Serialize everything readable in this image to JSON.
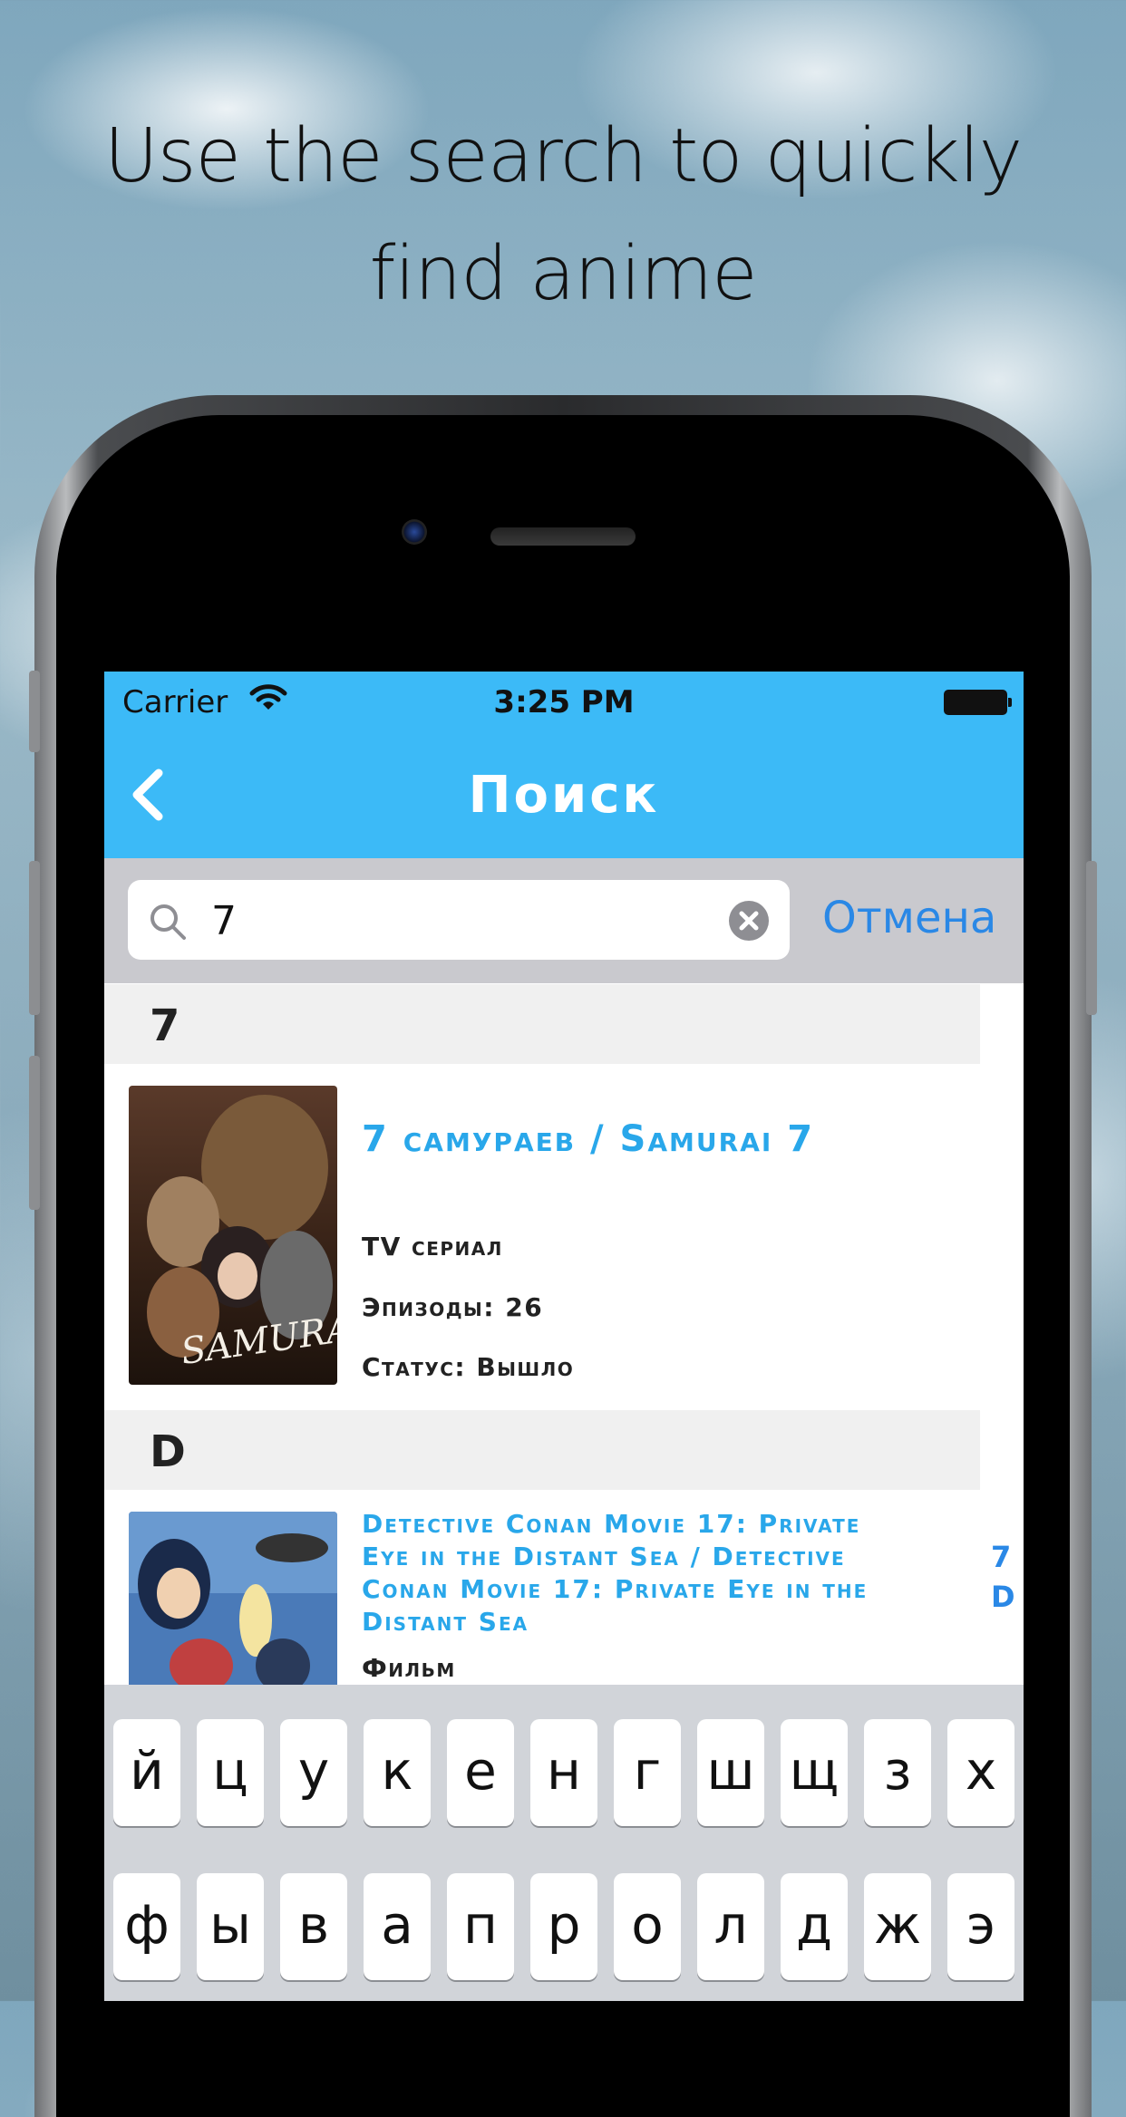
{
  "headline": {
    "line1": "Use the search to quickly",
    "line2": "find anime"
  },
  "status_bar": {
    "carrier": "Carrier",
    "time": "3:25 PM"
  },
  "nav": {
    "title": "Поиск"
  },
  "search": {
    "value": "7",
    "cancel_label": "Отмена"
  },
  "sections": [
    {
      "header": "7",
      "items": [
        {
          "title": "7 самураев / Samurai 7",
          "type": "TV сериал",
          "episodes": "Эпизоды: 26",
          "status": "Статус: Вышло"
        }
      ]
    },
    {
      "header": "D",
      "items": [
        {
          "title_lines": [
            "Detective Conan Movie 17: Private",
            "Eye in the Distant Sea / Detective",
            "Conan Movie 17: Private Eye in the",
            "Distant Sea"
          ],
          "type": "Фильм"
        }
      ]
    }
  ],
  "section_index": [
    "7",
    "D"
  ],
  "keyboard": {
    "row1": [
      "й",
      "ц",
      "у",
      "к",
      "е",
      "н",
      "г",
      "ш",
      "щ",
      "з",
      "х"
    ],
    "row2": [
      "ф",
      "ы",
      "в",
      "а",
      "п",
      "р",
      "о",
      "л",
      "д",
      "ж",
      "э"
    ]
  },
  "colors": {
    "nav_bar": "#3cbaf7",
    "title_accent": "#29a7ea",
    "cancel": "#2a88e6",
    "search_bar_bg": "#c9c9ce",
    "keyboard_bg": "#d1d4d9"
  }
}
